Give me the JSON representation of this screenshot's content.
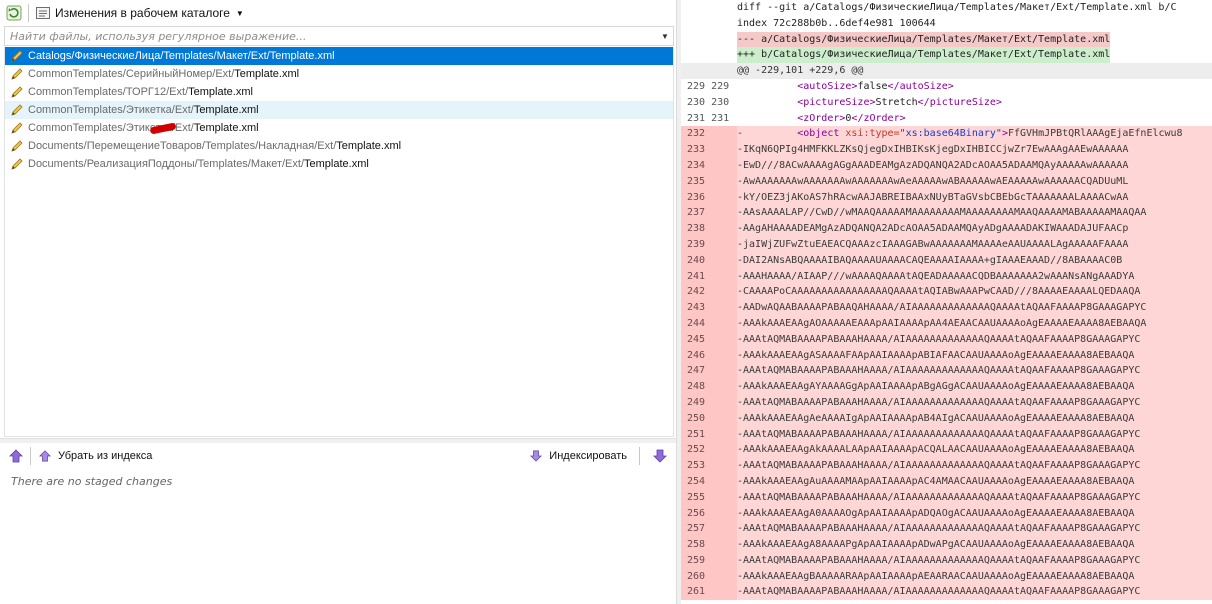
{
  "toolbar": {
    "dropdown_label": "Изменения в рабочем каталоге"
  },
  "filter": {
    "placeholder": "Найти файлы, используя регулярное выражение..."
  },
  "files": [
    {
      "path": "Catalogs/ФизическиеЛица/Templates/Макет/Ext/",
      "name": "Template.xml"
    },
    {
      "path": "CommonTemplates/СерийныйНомер/Ext/",
      "name": "Template.xml"
    },
    {
      "path": "CommonTemplates/ТОРГ12/Ext/",
      "name": "Template.xml"
    },
    {
      "path": "CommonTemplates/Этикетка/Ext/",
      "name": "Template.xml"
    },
    {
      "path_a": "CommonTemplates/Этикетка",
      "path_b": "/Ext/",
      "name": "Template.xml"
    },
    {
      "path": "Documents/ПеремещениеТоваров/Templates/Накладная/Ext/",
      "name": "Template.xml"
    },
    {
      "path": "Documents/РеализацияПоддоны/Templates/Макет/Ext/",
      "name": "Template.xml"
    }
  ],
  "staged": {
    "unstage_label": "Убрать из индекса",
    "stage_label": "Индексировать",
    "empty_message": "There are no staged changes"
  },
  "diff": {
    "header1": "diff --git a/Catalogs/ФизическиеЛица/Templates/Макет/Ext/Template.xml b/C",
    "header2": "index 72c288b0b..6def4e981 100644",
    "minus_file": "--- a/Catalogs/ФизическиеЛица/Templates/Макет/Ext/Template.xml",
    "plus_file": "+++ b/Catalogs/ФизическиеЛица/Templates/Макет/Ext/Template.xml",
    "hunk": "@@ -229,101 +229,6 @@",
    "context": [
      {
        "old": "229",
        "new": "229",
        "open": "<autoSize>",
        "text": "false",
        "close": "</autoSize>"
      },
      {
        "old": "230",
        "new": "230",
        "open": "<pictureSize>",
        "text": "Stretch",
        "close": "</pictureSize>"
      },
      {
        "old": "231",
        "new": "231",
        "open": "<zOrder>",
        "text": "0",
        "close": "</zOrder>"
      }
    ],
    "object_line": {
      "num": "232",
      "prefix": "-         ",
      "tag_open": "<object ",
      "attr": "xsi:type=",
      "value": "\"xs:base64Binary\"",
      "tag_close": ">",
      "content": "FfGVHmJPBtQRlAAAgEjaEfnElcwu8"
    },
    "deleted": [
      {
        "num": "233",
        "text": "-IKqN6QPIg4HMFKKLZKsQjegDxIHBIKsKjegDxIHBICCjwZr7EwAAAgAAEwAAAAAA"
      },
      {
        "num": "234",
        "text": "-EwD///8ACwAAAAgAGgAAADEAMgAzADQANQA2ADcAOAA5ADAAMQAyAAAAAwAAAAAA"
      },
      {
        "num": "235",
        "text": "-AwAAAAAAAwAAAAAAAwAAAAAAAwAeAAAAAwABAAAAAwAEAAAAAwAAAAAACQADUuML"
      },
      {
        "num": "236",
        "text": "-kY/OEZ3jAKoAS7hRAcwAAJABREIBAAxNUyBTaGVsbCBEbGcTAAAAAAALAAAACwAA"
      },
      {
        "num": "237",
        "text": "-AAsAAAALAP//CwD//wMAAQAAAAAMAAAAAAAAMAAAAAAAAMAAQAAAAMABAAAAAMAAQAA"
      },
      {
        "num": "238",
        "text": "-AAgAHAAAADEAMgAzADQANQA2ADcAOAA5ADAAMQAyADgAAAADAKIWAAADAJUFAACp"
      },
      {
        "num": "239",
        "text": "-jaIWjZUFwZtuEAEACQAAAzcIAAAGABwAAAAAAAMAAAAeAAUAAAALAgAAAAAFAAAA"
      },
      {
        "num": "240",
        "text": "-DAI2ANsABQAAAAIBAQAAAAUAAAACAQEAAAAIAAAA+gIAAAEAAAD//8ABAAAAC0B"
      },
      {
        "num": "241",
        "text": "-AAAHAAAA/AIAAP///wAAAAQAAAAtAQEADAAAAACQDBAAAAAAA2wAAANsANgAAADYA"
      },
      {
        "num": "242",
        "text": "-CAAAAPoCAAAAAAAAAAAAAAAAQAAAAtAQIABwAAAPwCAAD///8AAAAEAAAALQEDAAQA"
      },
      {
        "num": "243",
        "text": "-AADwAQAABAAAAPABAAQAHAAAA/AIAAAAAAAAAAAAAQAAAAtAQAAFAAAAP8GAAAGAPYC"
      },
      {
        "num": "244",
        "text": "-AAAkAAAEAAgAOAAAAAEAAApAAIAAAApAA4AEAACAAUAAAAoAgEAAAAEAAAA8AEBAAQA"
      },
      {
        "num": "245",
        "text": "-AAAtAQMABAAAAPABAAAHAAAA/AIAAAAAAAAAAAAAQAAAAtAQAAFAAAAP8GAAAGAPYC"
      },
      {
        "num": "246",
        "text": "-AAAkAAAEAAgASAAAAFAApAAIAAAApABIAFAACAAUAAAAoAgEAAAAEAAAA8AEBAAQA"
      },
      {
        "num": "247",
        "text": "-AAAtAQMABAAAAPABAAAHAAAA/AIAAAAAAAAAAAAAQAAAAtAQAAFAAAAP8GAAAGAPYC"
      },
      {
        "num": "248",
        "text": "-AAAkAAAEAAgAYAAAAGgApAAIAAAApABgAGgACAAUAAAAoAgEAAAAEAAAA8AEBAAQA"
      },
      {
        "num": "249",
        "text": "-AAAtAQMABAAAAPABAAAHAAAA/AIAAAAAAAAAAAAAQAAAAtAQAAFAAAAP8GAAAGAPYC"
      },
      {
        "num": "250",
        "text": "-AAAkAAAEAAgAeAAAAIgApAAIAAAApAB4AIgACAAUAAAAoAgEAAAAEAAAA8AEBAAQA"
      },
      {
        "num": "251",
        "text": "-AAAtAQMABAAAAPABAAAHAAAA/AIAAAAAAAAAAAAAQAAAAtAQAAFAAAAP8GAAAGAPYC"
      },
      {
        "num": "252",
        "text": "-AAAkAAAEAAgAkAAAALAApAAIAAAApACQALAACAAUAAAAoAgEAAAAEAAAA8AEBAAQA"
      },
      {
        "num": "253",
        "text": "-AAAtAQMABAAAAPABAAAHAAAA/AIAAAAAAAAAAAAAQAAAAtAQAAFAAAAP8GAAAGAPYC"
      },
      {
        "num": "254",
        "text": "-AAAkAAAEAAgAuAAAAMAApAAIAAAApAC4AMAACAAUAAAAoAgEAAAAEAAAA8AEBAAQA"
      },
      {
        "num": "255",
        "text": "-AAAtAQMABAAAAPABAAAHAAAA/AIAAAAAAAAAAAAAQAAAAtAQAAFAAAAP8GAAAGAPYC"
      },
      {
        "num": "256",
        "text": "-AAAkAAAEAAgA0AAAAOgApAAIAAAApADQAOgACAAUAAAAoAgEAAAAEAAAA8AEBAAQA"
      },
      {
        "num": "257",
        "text": "-AAAtAQMABAAAAPABAAAHAAAA/AIAAAAAAAAAAAAAQAAAAtAQAAFAAAAP8GAAAGAPYC"
      },
      {
        "num": "258",
        "text": "-AAAkAAAEAAgA8AAAAPgApAAIAAAApADwAPgACAAUAAAAoAgEAAAAEAAAA8AEBAAQA"
      },
      {
        "num": "259",
        "text": "-AAAtAQMABAAAAPABAAAHAAAA/AIAAAAAAAAAAAAAQAAAAtAQAAFAAAAP8GAAAGAPYC"
      },
      {
        "num": "260",
        "text": "-AAAkAAAEAAgBAAAAARAApAAIAAAApAEAARAACAAUAAAAoAgEAAAAEAAAA8AEBAAQA"
      },
      {
        "num": "261",
        "text": "-AAAtAQMABAAAAPABAAAHAAAA/AIAAAAAAAAAAAAAQAAAAtAQAAFAAAAP8GAAAGAPYC"
      }
    ]
  },
  "colors": {
    "selected_row": "#0078d7",
    "deleted_bg": "#ffd6d6",
    "added_header_bg": "#cdeecd",
    "removed_header_bg": "#f6c9c9"
  }
}
